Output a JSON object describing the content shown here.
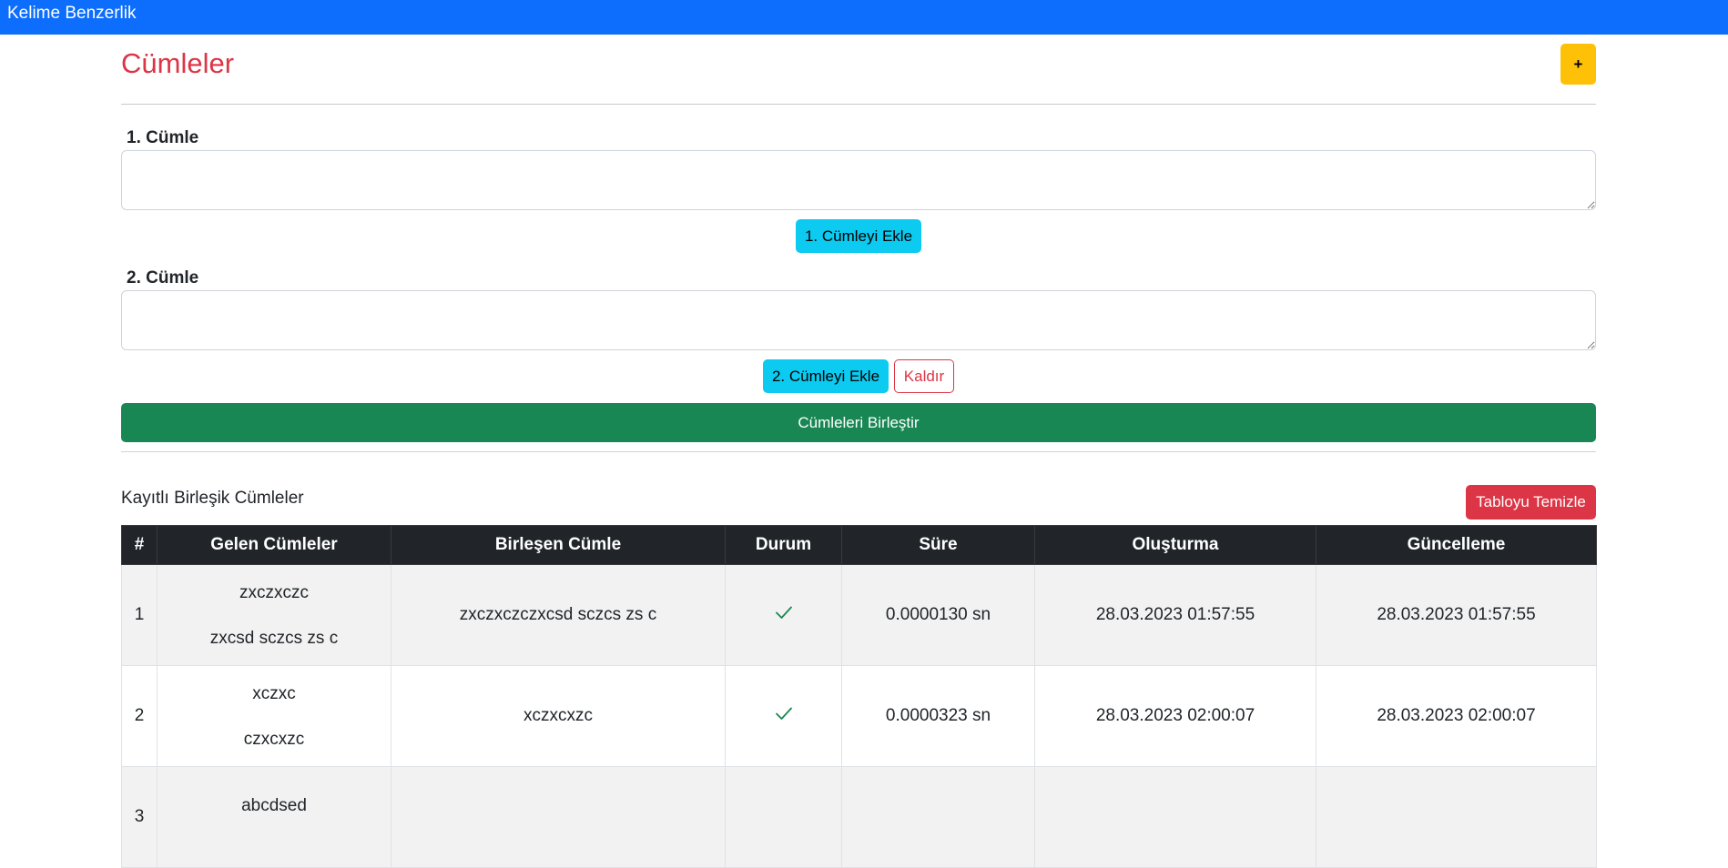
{
  "navbar": {
    "brand": "Kelime Benzerlik"
  },
  "page": {
    "title": "Cümleler",
    "add_label": "+"
  },
  "form": {
    "sentence1": {
      "label": "1. Cümle",
      "value": "",
      "add_label": "1. Cümleyi Ekle"
    },
    "sentence2": {
      "label": "2. Cümle",
      "value": "",
      "add_label": "2. Cümleyi Ekle",
      "remove_label": "Kaldır"
    },
    "merge_label": "Cümleleri Birleştir"
  },
  "table_section": {
    "title": "Kayıtlı Birleşik Cümleler",
    "clear_label": "Tabloyu Temizle",
    "columns": [
      "#",
      "Gelen Cümleler",
      "Birleşen Cümle",
      "Durum",
      "Süre",
      "Oluşturma",
      "Güncelleme"
    ],
    "rows": [
      {
        "index": "1",
        "incoming": [
          "zxczxczc",
          "zxcsd sczcs zs c"
        ],
        "merged": "zxczxczczxcsd sczcs zs c",
        "status_icon": "check-icon",
        "duration": "0.0000130 sn",
        "created": "28.03.2023 01:57:55",
        "updated": "28.03.2023 01:57:55"
      },
      {
        "index": "2",
        "incoming": [
          "xczxc",
          "czxcxzc"
        ],
        "merged": "xczxcxzc",
        "status_icon": "check-icon",
        "duration": "0.0000323 sn",
        "created": "28.03.2023 02:00:07",
        "updated": "28.03.2023 02:00:07"
      },
      {
        "index": "3",
        "incoming": [
          "abcdsed",
          ""
        ],
        "merged": "",
        "status_icon": "",
        "duration": "",
        "created": "",
        "updated": ""
      }
    ]
  },
  "colors": {
    "navbar": "#0d6efd",
    "title": "#dc3545",
    "status_ok": "#198754"
  }
}
